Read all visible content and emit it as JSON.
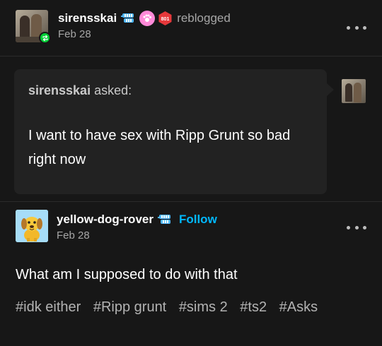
{
  "reblog_header": {
    "blog_name": "sirensskai",
    "action_label": "reblogged",
    "date": "Feb 28",
    "badges": [
      "chattering-teeth-badge-icon",
      "paw-badge-icon",
      "hex-badge-icon"
    ],
    "hex_badge_text": "801",
    "reblog_icon": "reblog-icon"
  },
  "ask": {
    "asker_name": "sirensskai",
    "asked_label": "asked:",
    "question": "I want to have sex with Ripp Grunt so bad right now"
  },
  "answer": {
    "blog_name": "yellow-dog-rover",
    "follow_label": "Follow",
    "date": "Feb 28",
    "text": "What am I supposed to do with that",
    "tags": [
      "#idk either",
      "#Ripp grunt",
      "#sims 2",
      "#ts2",
      "#Asks"
    ]
  },
  "colors": {
    "background": "#171717",
    "ask_box": "#222222",
    "follow_blue": "#00b8ff",
    "reblog_green": "#00cf35",
    "muted_text": "#a6a6a6"
  }
}
